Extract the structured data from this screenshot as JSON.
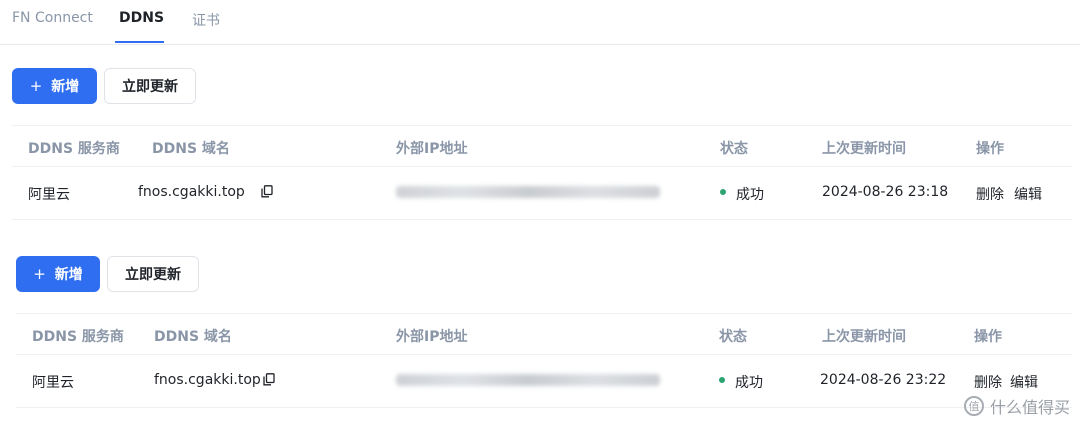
{
  "tabs": [
    {
      "label": "FN Connect",
      "active": false
    },
    {
      "label": "DDNS",
      "active": true
    },
    {
      "label": "证书",
      "active": false
    }
  ],
  "toolbar": {
    "add_label": "新增",
    "update_label": "立即更新"
  },
  "table": {
    "columns": [
      "DDNS 服务商",
      "DDNS 域名",
      "外部IP地址",
      "状态",
      "上次更新时间",
      "操作"
    ]
  },
  "records": [
    {
      "provider": "阿里云",
      "domain": "fnos.cgakki.top",
      "status": "成功",
      "updated": "2024-08-26 23:18",
      "actions": [
        "删除",
        "编辑"
      ]
    },
    {
      "provider": "阿里云",
      "domain": "fnos.cgakki.top",
      "status": "成功",
      "updated": "2024-08-26 23:22",
      "actions": [
        "删除",
        "编辑"
      ]
    }
  ],
  "watermark": {
    "text": "什么值得买",
    "icon": "zhi-icon",
    "glyph": "值"
  },
  "colors": {
    "accent": "#2f6ef0",
    "success": "#2ba471"
  }
}
